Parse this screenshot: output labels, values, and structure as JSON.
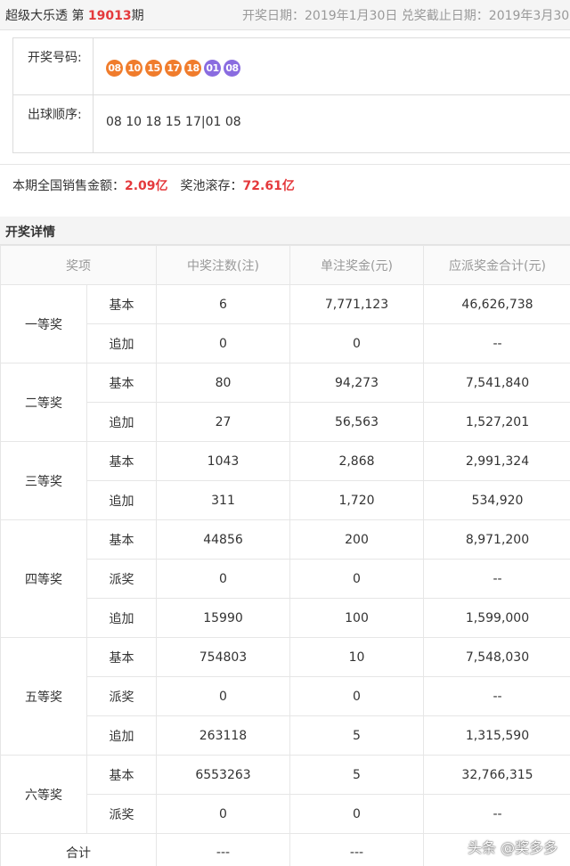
{
  "header": {
    "game_name": "超级大乐透 第",
    "issue_no": "19013",
    "issue_suffix": "期",
    "dates": "开奖日期：2019年1月30日 兑奖截止日期：2019年3月30"
  },
  "draw": {
    "numbers_label": "开奖号码:",
    "red_balls": [
      "08",
      "10",
      "15",
      "17",
      "18"
    ],
    "blue_balls": [
      "01",
      "08"
    ],
    "order_label": "出球顺序:",
    "order_text": "08 10 18 15 17|01 08"
  },
  "sales": {
    "sales_label": "本期全国销售金额：",
    "sales_amount": "2.09亿",
    "pool_label": "奖池滚存：",
    "pool_amount": "72.61亿"
  },
  "details": {
    "title": "开奖详情",
    "columns": [
      "奖项",
      "中奖注数(注)",
      "单注奖金(元)",
      "应派奖金合计(元)"
    ],
    "groups": [
      {
        "name": "一等奖",
        "rows": [
          {
            "type": "基本",
            "count": "6",
            "prize": "7,771,123",
            "total": "46,626,738"
          },
          {
            "type": "追加",
            "count": "0",
            "prize": "0",
            "total": "--"
          }
        ]
      },
      {
        "name": "二等奖",
        "rows": [
          {
            "type": "基本",
            "count": "80",
            "prize": "94,273",
            "total": "7,541,840"
          },
          {
            "type": "追加",
            "count": "27",
            "prize": "56,563",
            "total": "1,527,201"
          }
        ]
      },
      {
        "name": "三等奖",
        "rows": [
          {
            "type": "基本",
            "count": "1043",
            "prize": "2,868",
            "total": "2,991,324"
          },
          {
            "type": "追加",
            "count": "311",
            "prize": "1,720",
            "total": "534,920"
          }
        ]
      },
      {
        "name": "四等奖",
        "rows": [
          {
            "type": "基本",
            "count": "44856",
            "prize": "200",
            "total": "8,971,200"
          },
          {
            "type": "派奖",
            "count": "0",
            "prize": "0",
            "total": "--"
          },
          {
            "type": "追加",
            "count": "15990",
            "prize": "100",
            "total": "1,599,000"
          }
        ]
      },
      {
        "name": "五等奖",
        "rows": [
          {
            "type": "基本",
            "count": "754803",
            "prize": "10",
            "total": "7,548,030"
          },
          {
            "type": "派奖",
            "count": "0",
            "prize": "0",
            "total": "--"
          },
          {
            "type": "追加",
            "count": "263118",
            "prize": "5",
            "total": "1,315,590"
          }
        ]
      },
      {
        "name": "六等奖",
        "rows": [
          {
            "type": "基本",
            "count": "6553263",
            "prize": "5",
            "total": "32,766,315"
          },
          {
            "type": "派奖",
            "count": "0",
            "prize": "0",
            "total": "--"
          }
        ]
      }
    ],
    "total_row": {
      "label": "合计",
      "count": "---",
      "prize": "---",
      "total": ""
    }
  },
  "watermark": "头条 @奖多多"
}
